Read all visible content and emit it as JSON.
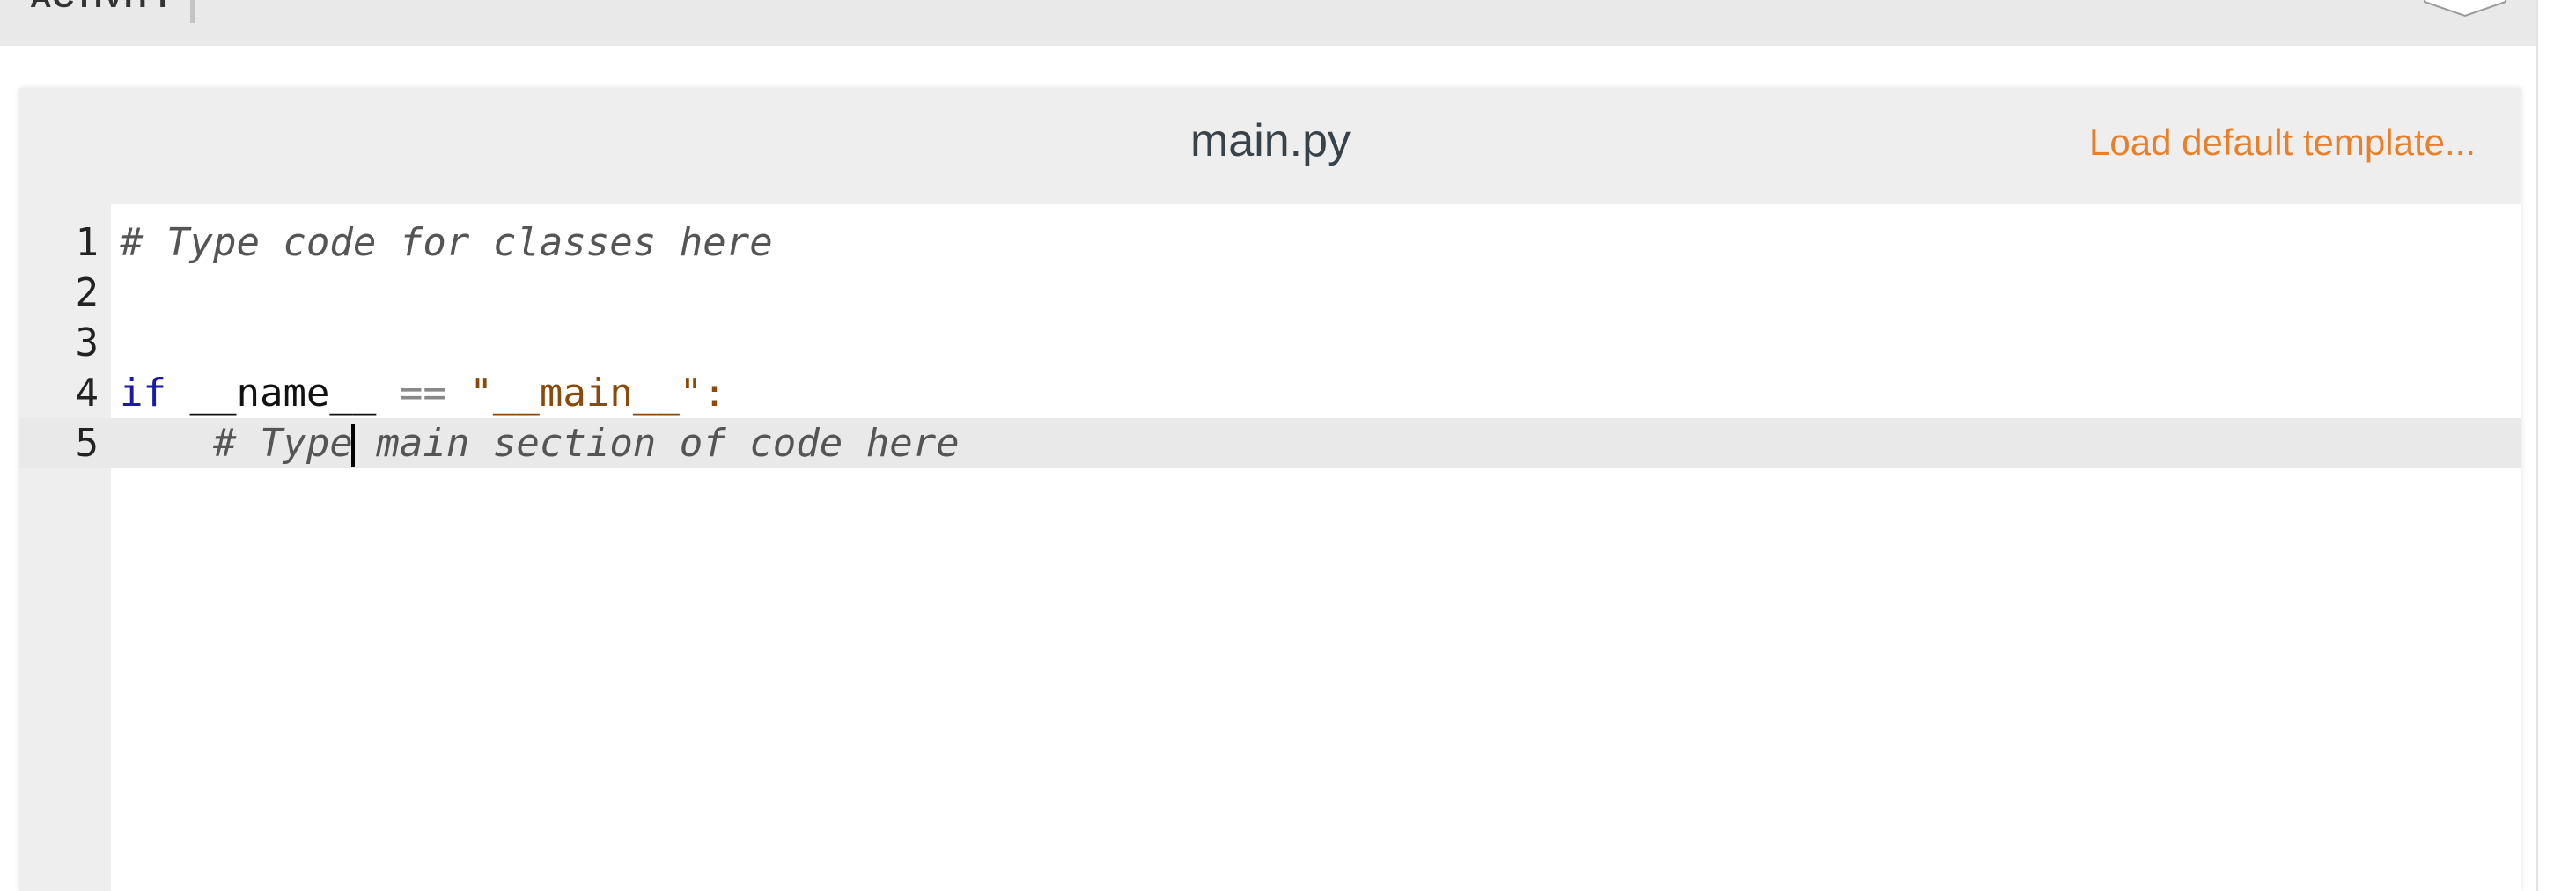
{
  "activity": {
    "label": "ACTIVITY",
    "description": ""
  },
  "editor": {
    "file_name": "main.py",
    "load_template_label": "Load default template...",
    "active_line": 5,
    "lines": [
      {
        "number": "1",
        "text": "# Type code for classes here"
      },
      {
        "number": "2",
        "text": ""
      },
      {
        "number": "3",
        "text": ""
      },
      {
        "number": "4",
        "text": "if __name__ == \"__main__\":"
      },
      {
        "number": "5",
        "text": "    # Type main section of code here"
      }
    ],
    "tokens": {
      "line1_comment": "# Type code for classes here",
      "line4_keyword": "if",
      "line4_name": "__name__",
      "line4_op": "==",
      "line4_string": "\"__main__\"",
      "line4_colon": ":",
      "line5_indent": "    ",
      "line5_comment_before_cursor": "# Type",
      "line5_comment_after_cursor": " main section of code here"
    }
  },
  "colors": {
    "accent": "#e8802b",
    "keyword": "#1a1aa6",
    "string": "#8a4a0b",
    "comment": "#555555"
  }
}
